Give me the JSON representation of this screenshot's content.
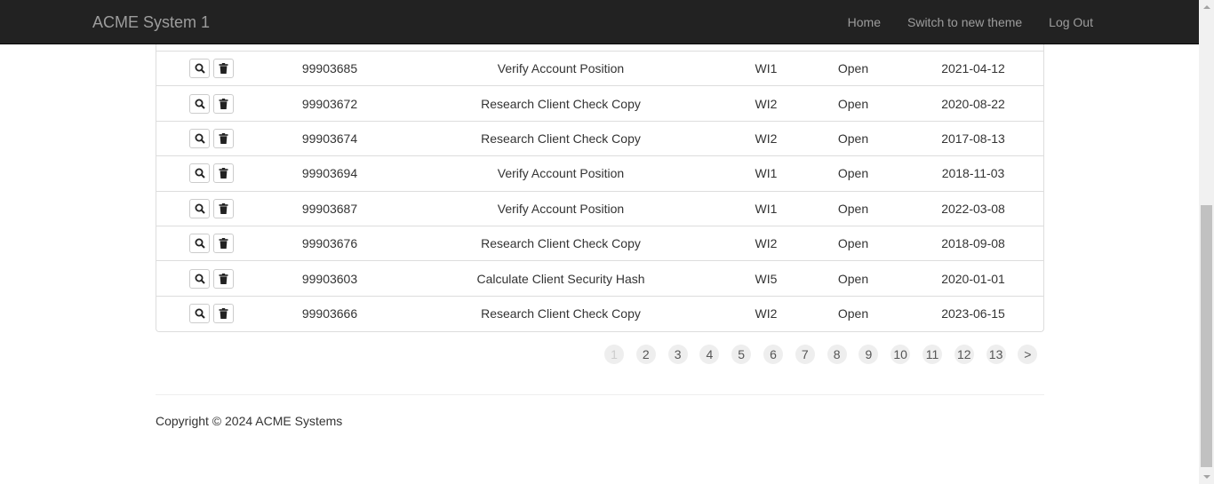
{
  "navbar": {
    "brand": "ACME System 1",
    "links": [
      "Home",
      "Switch to new theme",
      "Log Out"
    ]
  },
  "table": {
    "rows": [
      {
        "id": "99903685",
        "description": "Verify Account Position",
        "type": "WI1",
        "status": "Open",
        "date": "2021-04-12"
      },
      {
        "id": "99903672",
        "description": "Research Client Check Copy",
        "type": "WI2",
        "status": "Open",
        "date": "2020-08-22"
      },
      {
        "id": "99903674",
        "description": "Research Client Check Copy",
        "type": "WI2",
        "status": "Open",
        "date": "2017-08-13"
      },
      {
        "id": "99903694",
        "description": "Verify Account Position",
        "type": "WI1",
        "status": "Open",
        "date": "2018-11-03"
      },
      {
        "id": "99903687",
        "description": "Verify Account Position",
        "type": "WI1",
        "status": "Open",
        "date": "2022-03-08"
      },
      {
        "id": "99903676",
        "description": "Research Client Check Copy",
        "type": "WI2",
        "status": "Open",
        "date": "2018-09-08"
      },
      {
        "id": "99903603",
        "description": "Calculate Client Security Hash",
        "type": "WI5",
        "status": "Open",
        "date": "2020-01-01"
      },
      {
        "id": "99903666",
        "description": "Research Client Check Copy",
        "type": "WI2",
        "status": "Open",
        "date": "2023-06-15"
      }
    ],
    "row_icons": [
      "search-icon",
      "trash-icon"
    ]
  },
  "pagination": {
    "pages": [
      "1",
      "2",
      "3",
      "4",
      "5",
      "6",
      "7",
      "8",
      "9",
      "10",
      "11",
      "12",
      "13"
    ],
    "next": ">",
    "current": "1"
  },
  "footer": {
    "copyright": "Copyright © 2024 ACME Systems"
  },
  "colors": {
    "navbar_bg": "#222222",
    "nav_text": "#9d9d9d",
    "border": "#dddddd",
    "page_bubble": "#eeeeee"
  }
}
